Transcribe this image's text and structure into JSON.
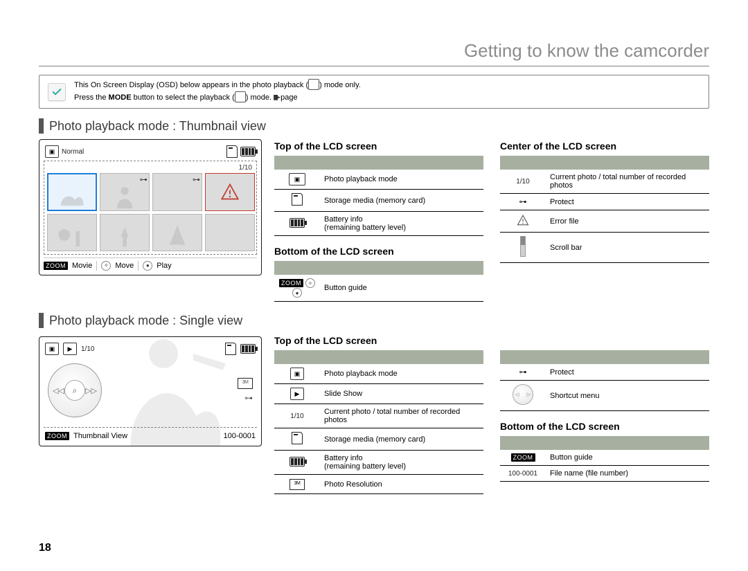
{
  "page_number": "18",
  "title": "Getting to know the camcorder",
  "info": {
    "line1_a": "This On Screen Display (OSD) below appears in the photo playback (",
    "line1_b": ") mode only.",
    "line2_a": "Press the ",
    "line2_mode": "MODE",
    "line2_b": " button to select the playback (",
    "line2_c": ") mode. ",
    "line2_d": "page"
  },
  "sections": {
    "thumb": "Photo playback mode : Thumbnail view",
    "single": "Photo playback mode : Single view"
  },
  "lcd_thumb": {
    "normal": "Normal",
    "count": "1/10",
    "zoom": "ZOOM",
    "movie": "Movie",
    "move": "Move",
    "play": "Play"
  },
  "lcd_single": {
    "count": "1/10",
    "zoom": "ZOOM",
    "thumb_view": "Thumbnail View",
    "file": "100-0001"
  },
  "tables": {
    "top_title": "Top of the LCD screen",
    "center_title": "Center of the LCD screen",
    "bottom_title": "Bottom of the LCD screen",
    "thumb_top": [
      {
        "icon": "photo-mode-icon",
        "desc": "Photo playback mode"
      },
      {
        "icon": "card-icon",
        "desc": "Storage media (memory card)"
      },
      {
        "icon": "battery-icon",
        "desc": "Battery info\n(remaining battery level)"
      }
    ],
    "thumb_center": [
      {
        "icon": "count-label",
        "label": "1/10",
        "desc": "Current photo / total number of recorded photos"
      },
      {
        "icon": "key-icon",
        "desc": "Protect"
      },
      {
        "icon": "warn-icon",
        "desc": "Error file"
      },
      {
        "icon": "scrollbar-icon",
        "desc": "Scroll bar"
      }
    ],
    "thumb_bottom": [
      {
        "icon": "button-guide-icon",
        "desc": "Button guide"
      }
    ],
    "single_top_left": [
      {
        "icon": "photo-mode-icon",
        "desc": "Photo playback mode"
      },
      {
        "icon": "slideshow-icon",
        "desc": "Slide Show"
      },
      {
        "icon": "count-label",
        "label": "1/10",
        "desc": "Current photo / total number of recorded photos"
      },
      {
        "icon": "card-icon",
        "desc": "Storage media (memory card)"
      },
      {
        "icon": "battery-icon",
        "desc": "Battery info\n(remaining battery level)"
      },
      {
        "icon": "resolution-icon",
        "desc": "Photo Resolution"
      }
    ],
    "single_top_right": [
      {
        "icon": "key-icon",
        "desc": "Protect"
      },
      {
        "icon": "shortcut-icon",
        "desc": "Shortcut menu"
      }
    ],
    "single_bottom": [
      {
        "icon": "zoom-chip-icon",
        "desc": "Button guide"
      },
      {
        "icon": "file-label",
        "label": "100-0001",
        "desc": "File name (file number)"
      }
    ]
  }
}
